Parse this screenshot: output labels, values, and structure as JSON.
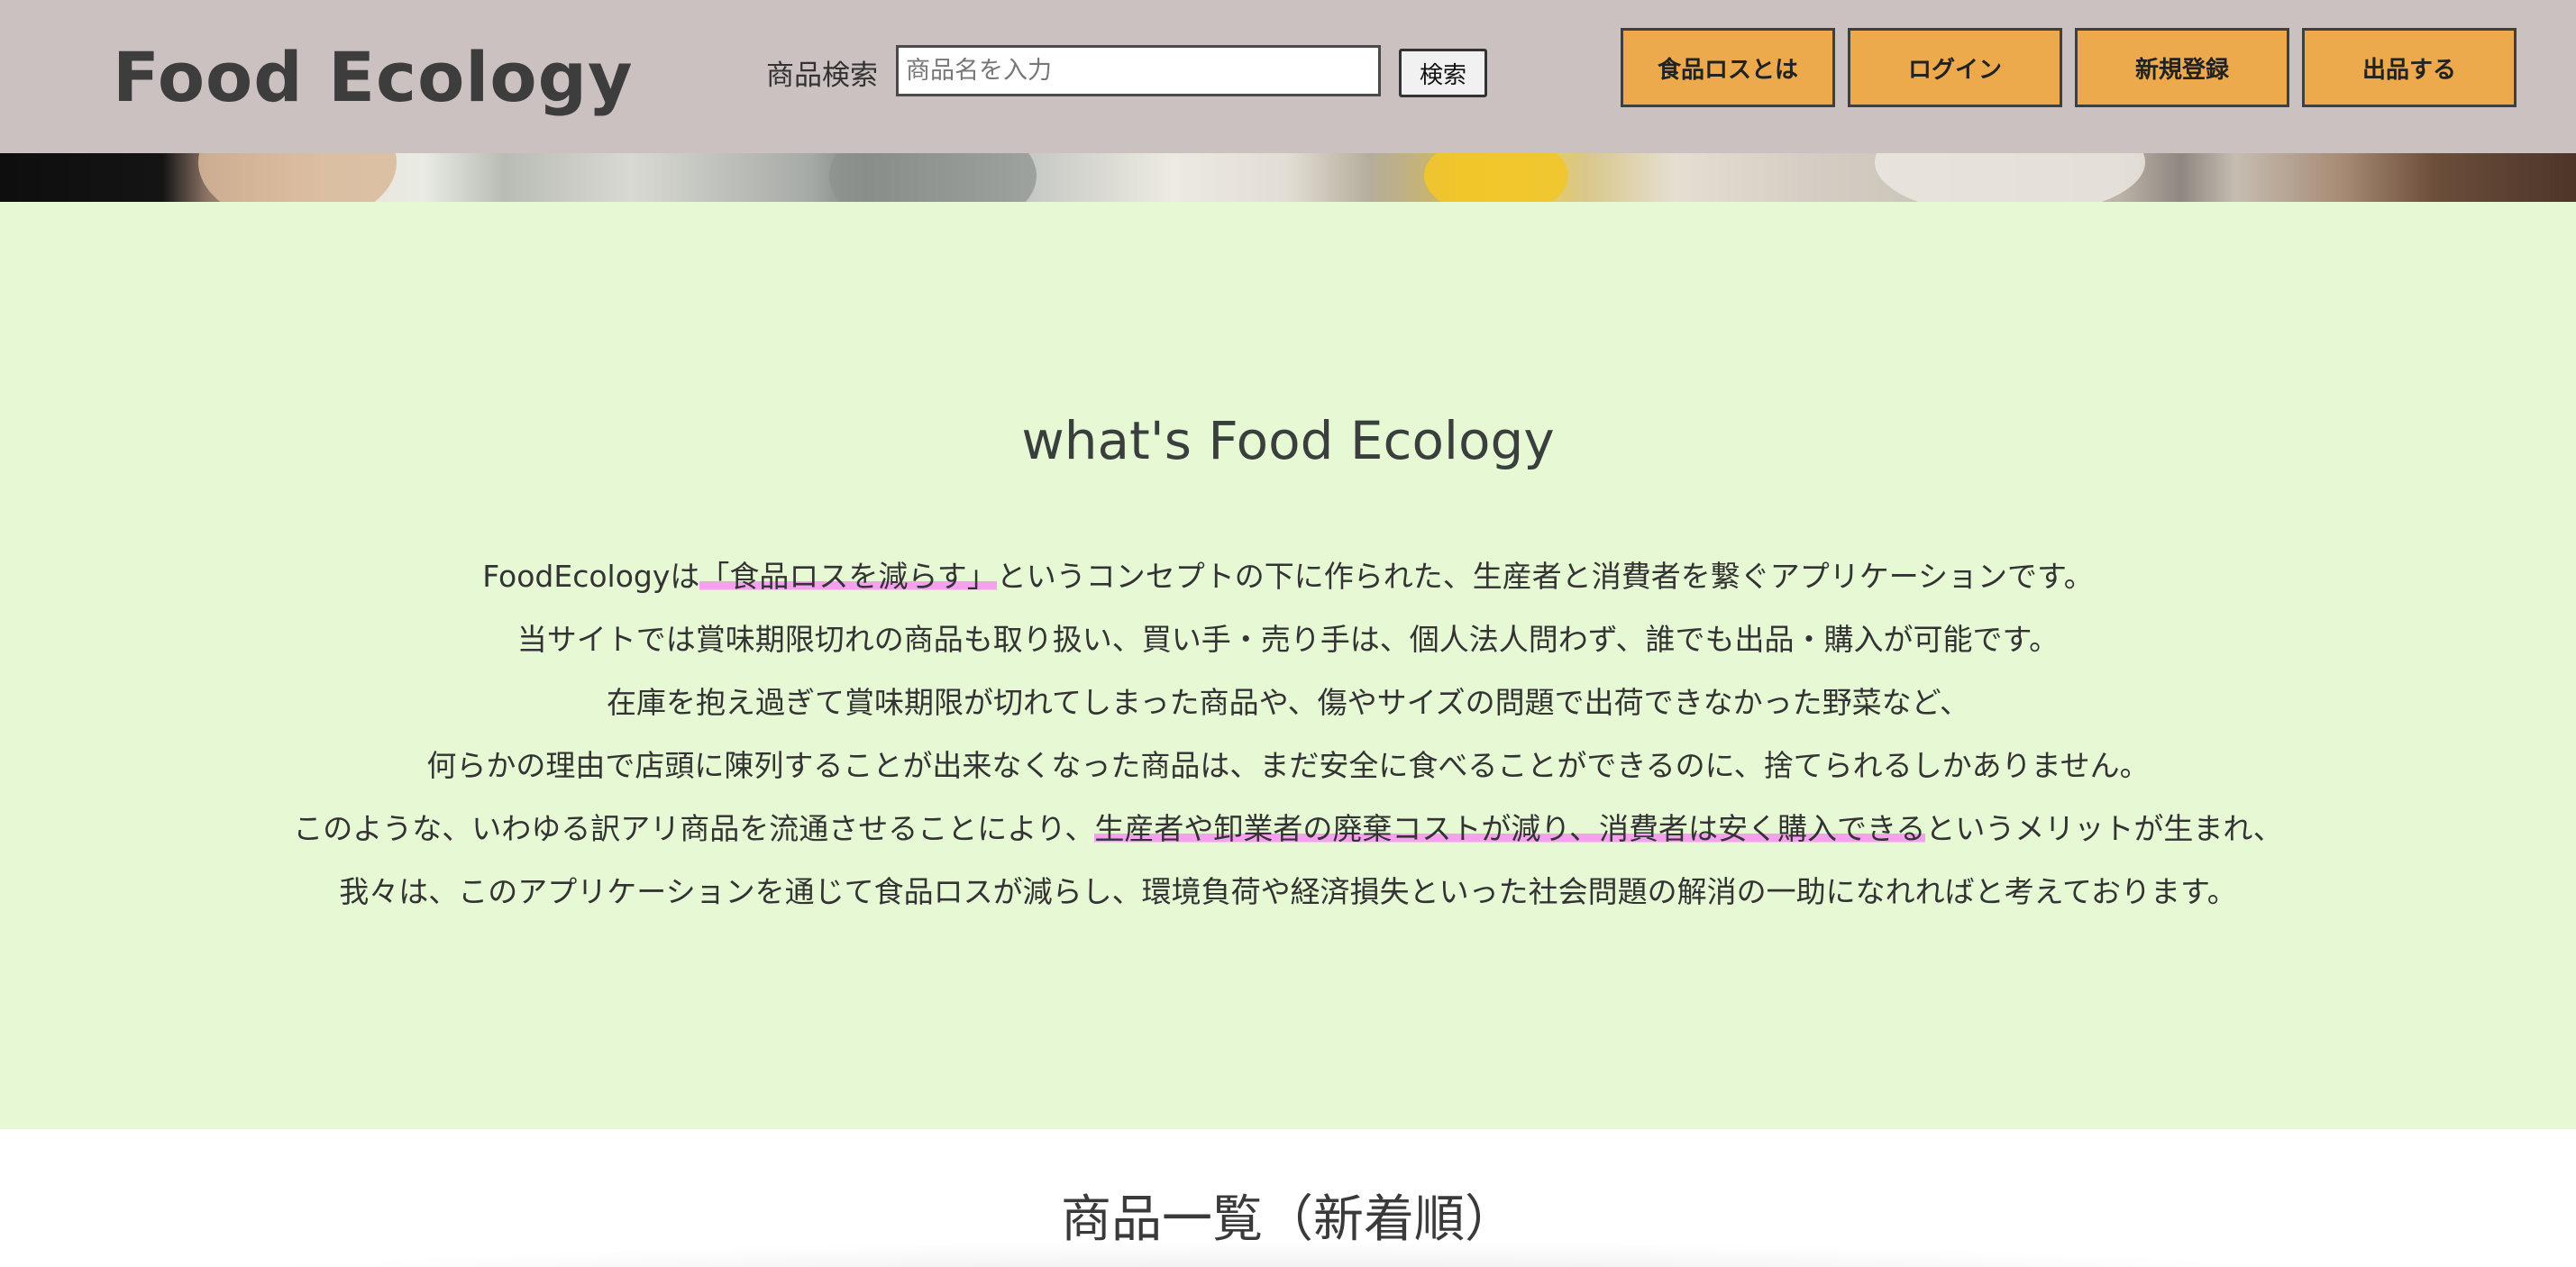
{
  "header": {
    "logo": "Food Ecology",
    "search": {
      "label": "商品検索",
      "placeholder": "商品名を入力",
      "value": "",
      "button_label": "検索"
    },
    "nav": [
      {
        "label": "食品ロスとは"
      },
      {
        "label": "ログイン"
      },
      {
        "label": "新規登録"
      },
      {
        "label": "出品する"
      }
    ]
  },
  "about": {
    "title": "what's Food Ecology",
    "lines": [
      {
        "before": "FoodEcologyは",
        "highlight": "「食品ロスを減らす」",
        "after": "というコンセプトの下に作られた、生産者と消費者を繋ぐアプリケーションです。"
      },
      {
        "before": "当サイトでは賞味期限切れの商品も取り扱い、買い手・売り手は、個人法人問わず、誰でも出品・購入が可能です。",
        "highlight": "",
        "after": ""
      },
      {
        "before": "在庫を抱え過ぎて賞味期限が切れてしまった商品や、傷やサイズの問題で出荷できなかった野菜など、",
        "highlight": "",
        "after": ""
      },
      {
        "before": "何らかの理由で店頭に陳列することが出来なくなった商品は、まだ安全に食べることができるのに、捨てられるしかありません。",
        "highlight": "",
        "after": ""
      },
      {
        "before": "このような、いわゆる訳アリ商品を流通させることにより、",
        "highlight": "生産者や卸業者の廃棄コストが減り、消費者は安く購入できる",
        "after": "というメリットが生まれ、"
      },
      {
        "before": "我々は、このアプリケーションを通じて食品ロスが減らし、環境負荷や経済損失といった社会問題の解消の一助になれればと考えております。",
        "highlight": "",
        "after": ""
      }
    ]
  },
  "products": {
    "title": "商品一覧（新着順）"
  },
  "colors": {
    "header_bg": "#cbc1c1",
    "nav_button": "#ecaa4c",
    "about_bg": "#e7f8d5",
    "highlight": "#f7a0f0"
  }
}
